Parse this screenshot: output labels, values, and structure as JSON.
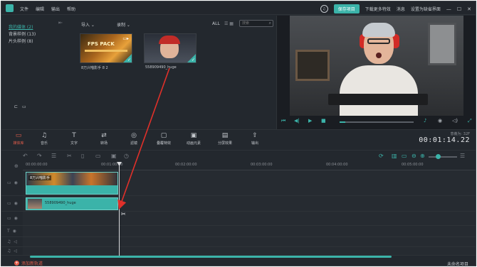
{
  "menu": [
    "文件",
    "编辑",
    "输出",
    "帮助"
  ],
  "topbar": {
    "save_label": "保存项目",
    "download_label": "下载更多特效",
    "messages_label": "消息",
    "default_layout_label": "设置为缺省界面",
    "minimize": "—",
    "maximize": "☐",
    "close": "✕"
  },
  "library": {
    "items": [
      "我的媒体 (2)",
      "背景样例 (13)",
      "片头样例 (8)"
    ]
  },
  "media_toolbar": {
    "import_label": "导入 ⌄",
    "record_label": "录制 ⌄",
    "all_label": "ALL",
    "search_placeholder": "搜索"
  },
  "media_items": [
    {
      "label": "8万兴喵影手 8 2",
      "thumb_text": "FPS PACK"
    },
    {
      "label": "558909490_huge"
    }
  ],
  "tools": [
    "媒体库",
    "音乐",
    "文字",
    "转场",
    "滤镜",
    "叠覆特效",
    "动画元素",
    "分屏效果",
    "输出"
  ],
  "timecode": {
    "label": "意義为: 32F",
    "value": "00:01:14.22"
  },
  "ruler_labels": [
    "00:00:00:00",
    "00:01:00:00",
    "00:02:00:00",
    "00:03:00:00",
    "00:04:00:00",
    "00:05:00:00"
  ],
  "clips": {
    "video_label": "8万兴喵影手",
    "photo_label": "558909490_huge"
  },
  "footer": {
    "add_track_label": "添加新轨道",
    "project_name": "未命名项目"
  },
  "preview": {
    "progress": 0.08
  },
  "colors": {
    "accent": "#3bb3a9",
    "active_red": "#e25d4b",
    "annotation_red": "#e0302a",
    "background": "#23282e"
  }
}
